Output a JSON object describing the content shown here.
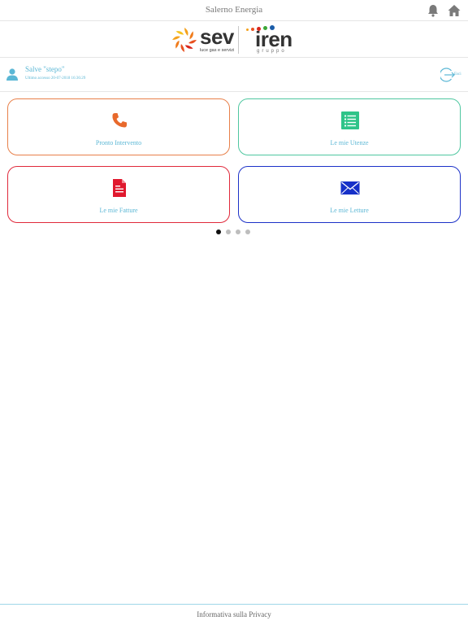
{
  "header": {
    "title": "Salerno Energia",
    "icons": [
      "bell-icon",
      "home-icon"
    ]
  },
  "logo": {
    "sev_text": "sev",
    "sev_tagline": "luce gas e servizi",
    "iren_text": "iren",
    "iren_tagline": "gruppo"
  },
  "user": {
    "greeting": "Salve \"stepo\"",
    "last_access": "Ultimo accesso 20-07-2018 16:36:29",
    "logout_label": "Esci"
  },
  "tiles": [
    {
      "label": "Pronto Intervento",
      "icon": "phone-icon",
      "color": "#e8692c"
    },
    {
      "label": "Le mie Utenze",
      "icon": "list-icon",
      "color": "#2fc489"
    },
    {
      "label": "Le mie Fatture",
      "icon": "document-icon",
      "color": "#e0182e"
    },
    {
      "label": "Le mie Letture",
      "icon": "envelope-icon",
      "color": "#1630c8"
    }
  ],
  "pager": {
    "pages": 4,
    "current": 1
  },
  "footer": {
    "privacy_label": "Informativa sulla Privacy"
  }
}
